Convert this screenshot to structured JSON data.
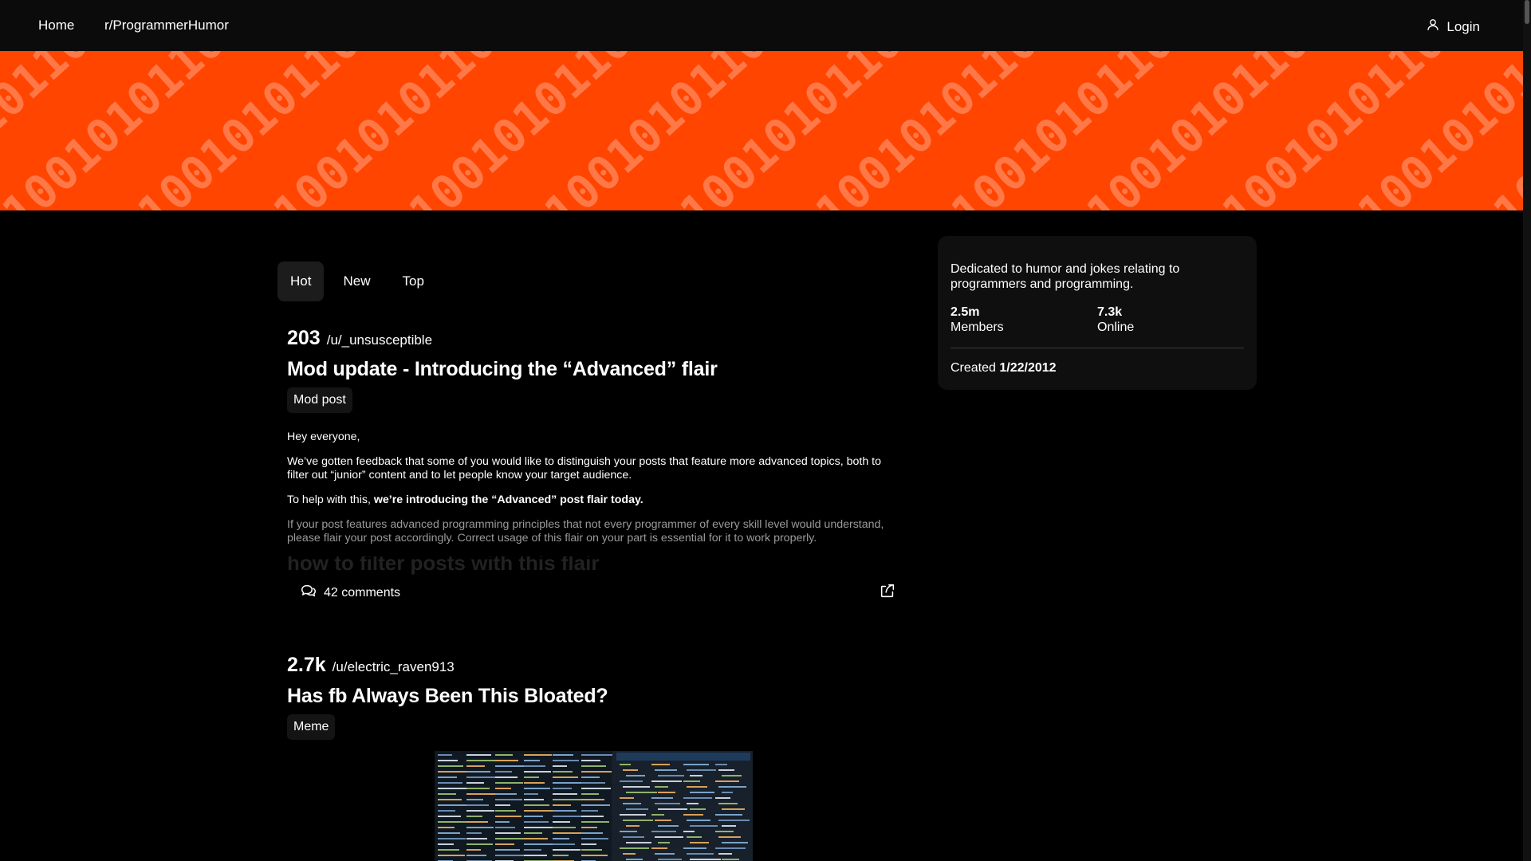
{
  "nav": {
    "home": "Home",
    "subreddit": "r/ProgrammerHumor",
    "login": "Login"
  },
  "banner": {
    "pattern_text": "01001010110100101101001011010010110100101",
    "color": "#ff4500"
  },
  "tabs": [
    {
      "label": "Hot",
      "active": true
    },
    {
      "label": "New",
      "active": false
    },
    {
      "label": "Top",
      "active": false
    }
  ],
  "posts": [
    {
      "score": "203",
      "author": "/u/_unsusceptible",
      "title": "Mod update - Introducing the “Advanced” flair",
      "flair": "Mod post",
      "body": {
        "p1": "Hey everyone,",
        "p2": "We’ve gotten feedback that some of you would like to distinguish your posts that feature more advanced topics, both to filter out “junior” content and to let people know your target audience.",
        "p3_prefix": "To help with this, ",
        "p3_bold": "we’re introducing the “Advanced” post flair today.",
        "p4": "If your post features advanced programming principles that not every programmer of every skill level would understand, please flair your post accordingly. Correct usage of this flair on your part is essential for it to work properly.",
        "heading": "how to filter posts with this flair"
      },
      "comments": "42 comments"
    },
    {
      "score": "2.7k",
      "author": "/u/electric_raven913",
      "title": "Has fb Always Been This Bloated?",
      "flair": "Meme"
    }
  ],
  "sidebar": {
    "description": "Dedicated to humor and jokes relating to programmers and programming.",
    "members_count": "2.5m",
    "members_label": "Members",
    "online_count": "7.3k",
    "online_label": "Online",
    "created_label": "Created",
    "created_date": "1/22/2012"
  },
  "icons": {
    "login": "user-icon",
    "comments": "comments-icon",
    "share": "share-icon"
  }
}
